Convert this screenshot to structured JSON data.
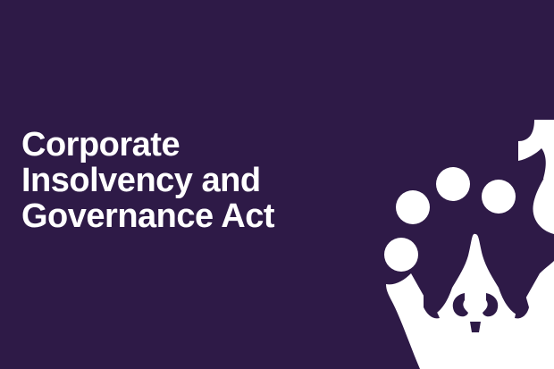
{
  "banner": {
    "background_color": "#2e1a47",
    "accent_color": "#ffffff",
    "title_lines": [
      "Corporate",
      "Insolvency and",
      "Governance Act"
    ],
    "emblem": "crown-icon"
  }
}
